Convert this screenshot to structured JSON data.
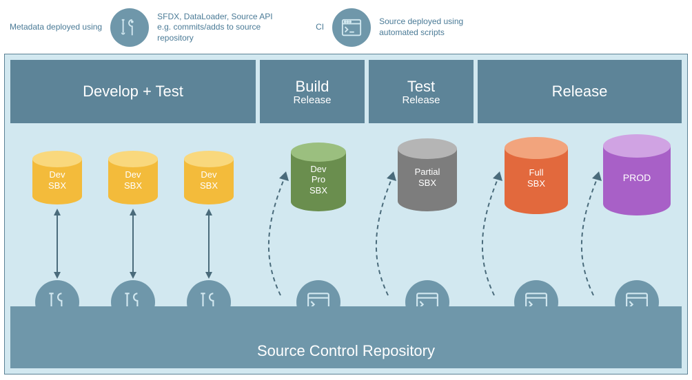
{
  "legend": {
    "left_before": "Metadata deployed using",
    "tools": "SFDX, DataLoader, Source API e.g. commits/adds to source repository",
    "cli_before": "CI",
    "cli": "Source deployed using automated scripts"
  },
  "stages": {
    "develop_test": {
      "title": "Develop + Test"
    },
    "build": {
      "title": "Build",
      "sub": "Release"
    },
    "test": {
      "title": "Test",
      "sub": "Release"
    },
    "release": {
      "title": "Release"
    }
  },
  "cylinders": {
    "dev1": "Dev\nSBX",
    "dev2": "Dev\nSBX",
    "dev3": "Dev\nSBX",
    "devpro": "Dev\nPro\nSBX",
    "partial": "Partial\nSBX",
    "full": "Full\nSBX",
    "prod": "PROD"
  },
  "repo": "Source Control Repository",
  "colors": {
    "header": "#5d8498",
    "bodyBg": "#d2e8f0",
    "repoBg": "#6f97aa",
    "dev": {
      "side": "#f3bb3b",
      "top": "#f9d87d"
    },
    "devpro": {
      "side": "#6a8e4e",
      "top": "#9bbf7f"
    },
    "partial": {
      "side": "#7d7d7d",
      "top": "#b5b5b5"
    },
    "full": {
      "side": "#e2693d",
      "top": "#f2a47d"
    },
    "prod": {
      "side": "#a860c7",
      "top": "#d0a3e3"
    }
  }
}
